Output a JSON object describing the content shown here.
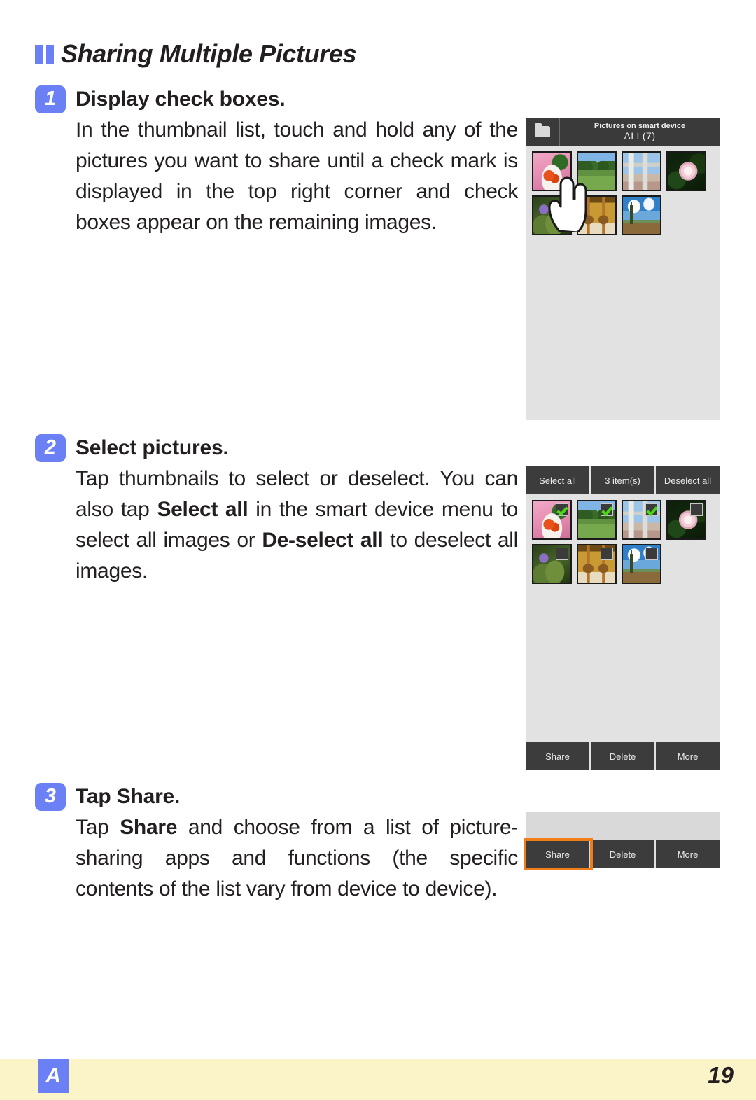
{
  "section": {
    "title": "Sharing Multiple Pictures",
    "bullet_color": "#6b80f5"
  },
  "steps": [
    {
      "number": "1",
      "title": "Display check boxes.",
      "body_html": "In the thumbnail list, touch and hold any of the pictures you want to share until a check mark is displayed in the top right corner and check boxes appear on the remaining images."
    },
    {
      "number": "2",
      "title": "Select pictures.",
      "body_html": "Tap thumbnails to select or deselect. You can also tap <b>Select all</b> in the smart device menu to select all images or <b>De-select all</b> to deselect all images."
    },
    {
      "number": "3",
      "title_prefix": "Tap ",
      "title_bold": "Share",
      "title_suffix": ".",
      "body_html": "Tap <b>Share</b> and choose from a list of picture-sharing apps and functions (the specific contents of the list vary from device to device)."
    }
  ],
  "mockups": {
    "one": {
      "folder_icon": "folder-icon",
      "header_line1": "Pictures on smart device",
      "header_line2": "ALL(7)",
      "hand_icon": "touch-hand-icon",
      "thumbnails": [
        {
          "name": "food-pasta",
          "checked": false,
          "box": false
        },
        {
          "name": "field-trees",
          "checked": false,
          "box": false
        },
        {
          "name": "industrial-towers",
          "checked": false,
          "box": false
        },
        {
          "name": "pink-rose",
          "checked": false,
          "box": false
        },
        {
          "name": "lily-pond",
          "checked": false,
          "box": false
        },
        {
          "name": "golden-temple",
          "checked": false,
          "box": false
        },
        {
          "name": "tree-mountain",
          "checked": false,
          "box": false
        }
      ]
    },
    "two": {
      "top_toolbar": [
        {
          "name": "select-all",
          "label": "Select all"
        },
        {
          "name": "item-count",
          "label": "3 item(s)"
        },
        {
          "name": "deselect-all",
          "label": "Deselect all"
        }
      ],
      "thumbnails": [
        {
          "name": "food-pasta",
          "checked": true,
          "box": true
        },
        {
          "name": "field-trees",
          "checked": true,
          "box": true
        },
        {
          "name": "industrial-towers",
          "checked": true,
          "box": true
        },
        {
          "name": "pink-rose",
          "checked": false,
          "box": true
        },
        {
          "name": "lily-pond",
          "checked": false,
          "box": true
        },
        {
          "name": "golden-temple",
          "checked": false,
          "box": true
        },
        {
          "name": "tree-mountain",
          "checked": false,
          "box": true
        }
      ],
      "bottom_toolbar": [
        {
          "name": "share",
          "label": "Share"
        },
        {
          "name": "delete",
          "label": "Delete"
        },
        {
          "name": "more",
          "label": "More"
        }
      ]
    },
    "three": {
      "highlight_color": "#f07d18",
      "bottom_toolbar": [
        {
          "name": "share",
          "label": "Share",
          "highlighted": true
        },
        {
          "name": "delete",
          "label": "Delete",
          "highlighted": false
        },
        {
          "name": "more",
          "label": "More",
          "highlighted": false
        }
      ]
    }
  },
  "footer": {
    "badge": "A",
    "page_number": "19",
    "band_color": "#fbf4c8"
  }
}
